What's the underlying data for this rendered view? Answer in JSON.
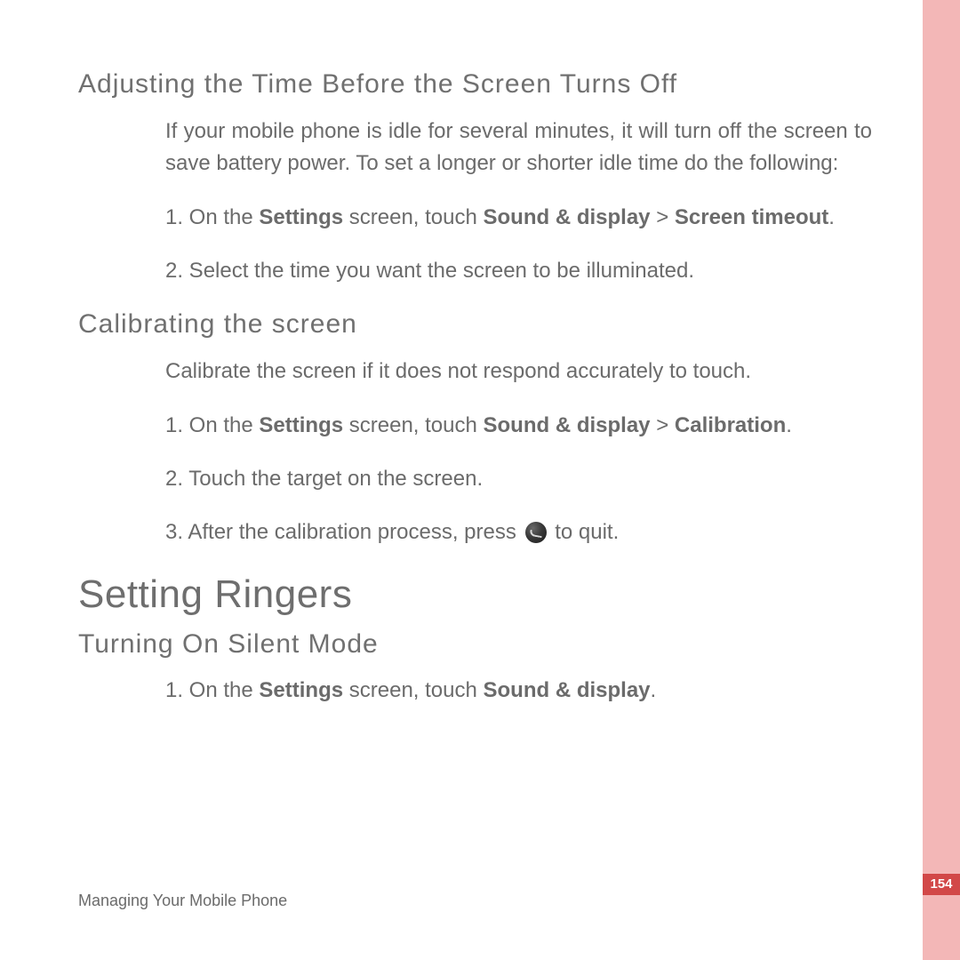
{
  "page_number": "154",
  "footer": "Managing Your Mobile Phone",
  "section1": {
    "heading": "Adjusting the Time Before the Screen Turns Off",
    "intro": "If your mobile phone is idle for several minutes, it will turn off the screen to save battery power. To set a longer or shorter idle time do the following:",
    "step1_pre": "1. On the ",
    "step1_b1": "Settings",
    "step1_mid1": " screen, touch ",
    "step1_b2": "Sound & display",
    "step1_mid2": " > ",
    "step1_b3": "Screen timeout",
    "step1_post": ".",
    "step2": "2. Select the time  you want the screen to be illuminated."
  },
  "section2": {
    "heading": "Calibrating the screen",
    "intro": "Calibrate the screen if it does not respond accurately to touch.",
    "step1_pre": "1. On the ",
    "step1_b1": "Settings",
    "step1_mid1": " screen, touch ",
    "step1_b2": "Sound & display",
    "step1_mid2": " > ",
    "step1_b3": "Calibration",
    "step1_post": ".",
    "step2": "2. Touch the target on the screen.",
    "step3_pre": "3. After the calibration process, press ",
    "step3_post": " to quit."
  },
  "section3": {
    "title": "Setting Ringers",
    "subheading": "Turning On Silent Mode",
    "step1_pre": "1. On the ",
    "step1_b1": "Settings",
    "step1_mid1": " screen, touch ",
    "step1_b2": "Sound & display",
    "step1_post": "."
  }
}
